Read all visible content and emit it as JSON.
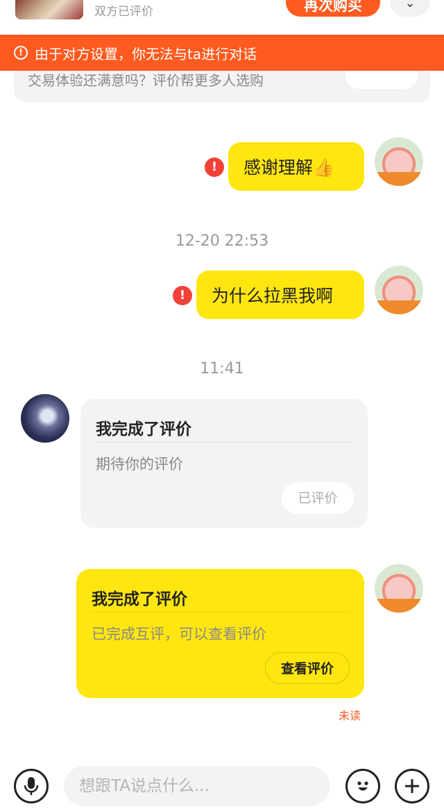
{
  "item_header": {
    "subtitle": "双方已评价",
    "rebuy_label": "再次购买",
    "more_glyph": "⌄"
  },
  "banner": {
    "icon_glyph": "!",
    "text": "由于对方设置，你无法与ta进行对话"
  },
  "review_prompt": {
    "text": "交易体验还满意吗？评价帮更多人选购"
  },
  "messages": [
    {
      "text": "感谢理解👍",
      "status_icon": "!"
    },
    {
      "text": "为什么拉黑我啊",
      "status_icon": "!"
    }
  ],
  "timestamps": [
    "12-20 22:53",
    "11:41"
  ],
  "other_review_card": {
    "title": "我完成了评价",
    "desc": "期待你的评价",
    "button": "已评价"
  },
  "my_review_card": {
    "title": "我完成了评价",
    "desc": "已完成互评，可以查看评价",
    "button": "查看评价",
    "status": "未读"
  },
  "input_bar": {
    "placeholder": "想跟TA说点什么..."
  },
  "colors": {
    "accent": "#ff5a1f",
    "bubble": "#ffe60f",
    "error": "#f24137",
    "card_gray": "#f3f3f5"
  },
  "icons": [
    "voice-icon",
    "emoji-icon",
    "plus-icon",
    "warning-icon",
    "send-failed-icon",
    "chevron-down-icon"
  ]
}
